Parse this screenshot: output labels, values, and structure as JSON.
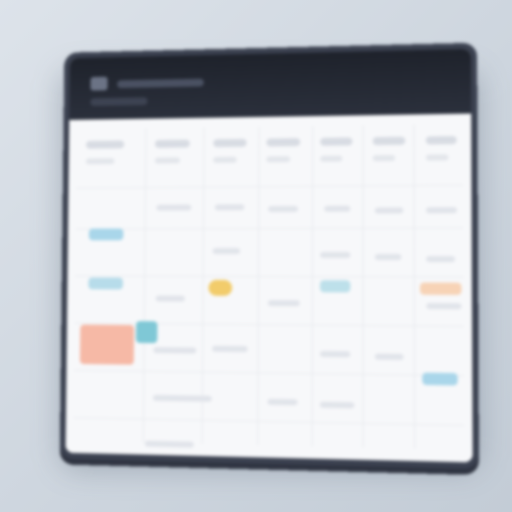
{
  "window": {
    "title": "",
    "columns": [
      "",
      "",
      "",
      "",
      "",
      "",
      ""
    ]
  },
  "colors": {
    "titlebar": "#2b303c",
    "frame": "#3b4150",
    "background": "#f7f8fa",
    "event_blue": "#a9d6ea",
    "event_teal": "#7fc8d6",
    "event_yellow": "#f2cc6b",
    "event_salmon": "#f6b9a6",
    "event_peach": "#f7d3b6"
  },
  "icons": {
    "app": "calendar-icon"
  }
}
